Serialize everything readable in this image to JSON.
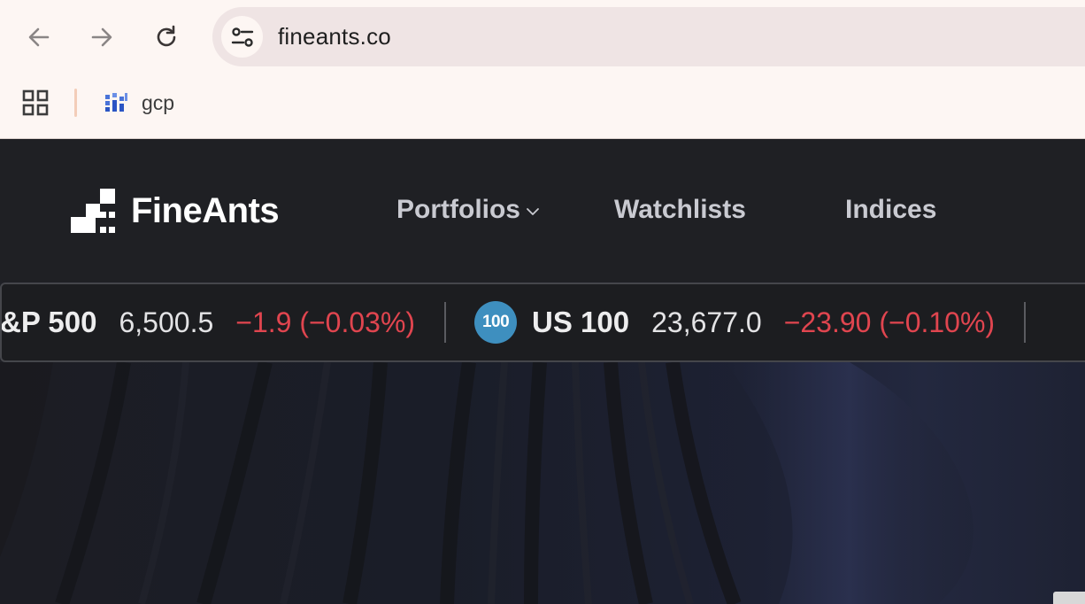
{
  "browser": {
    "url": "fineants.co",
    "bookmarks": [
      {
        "label": "gcp"
      }
    ]
  },
  "site": {
    "brand": "FineAnts",
    "nav": {
      "portfolios": "Portfolios",
      "watchlists": "Watchlists",
      "indices": "Indices"
    },
    "ticker": [
      {
        "name": "&P 500",
        "price": "6,500.5",
        "change": "−1.9 (−0.03%)",
        "badge": ""
      },
      {
        "name": "US 100",
        "price": "23,677.0",
        "change": "−23.90 (−0.10%)",
        "badge": "100"
      }
    ],
    "colors": {
      "negative": "#e0454f",
      "badge": "#3e8fbf",
      "header_bg": "#1f2024"
    }
  }
}
